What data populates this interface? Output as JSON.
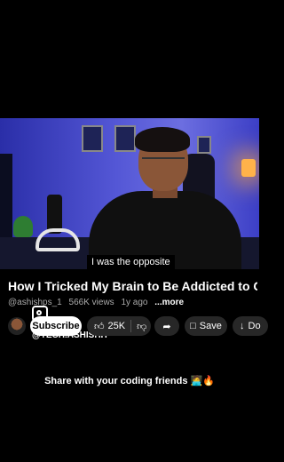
{
  "video": {
    "caption": "I was the opposite"
  },
  "details": {
    "title": "How I Tricked My Brain to Be Addicted to C..",
    "channel": "@ashishps_1",
    "views": "566K views",
    "age": "1y ago",
    "more": "...more",
    "watermark": "@TECH.ASHISHH"
  },
  "actions": {
    "subscribe": "Subscribe",
    "likes": "25K",
    "save": "Save",
    "download": "Do"
  },
  "overlay": {
    "share_text": "Share with your coding friends 🧑‍💻🔥"
  },
  "icons": {
    "like": "thumbs-up-icon",
    "dislike": "thumbs-down-icon",
    "share": "share-arrow-icon",
    "save": "bookmark-icon",
    "download": "download-icon",
    "instagram": "instagram-icon"
  }
}
